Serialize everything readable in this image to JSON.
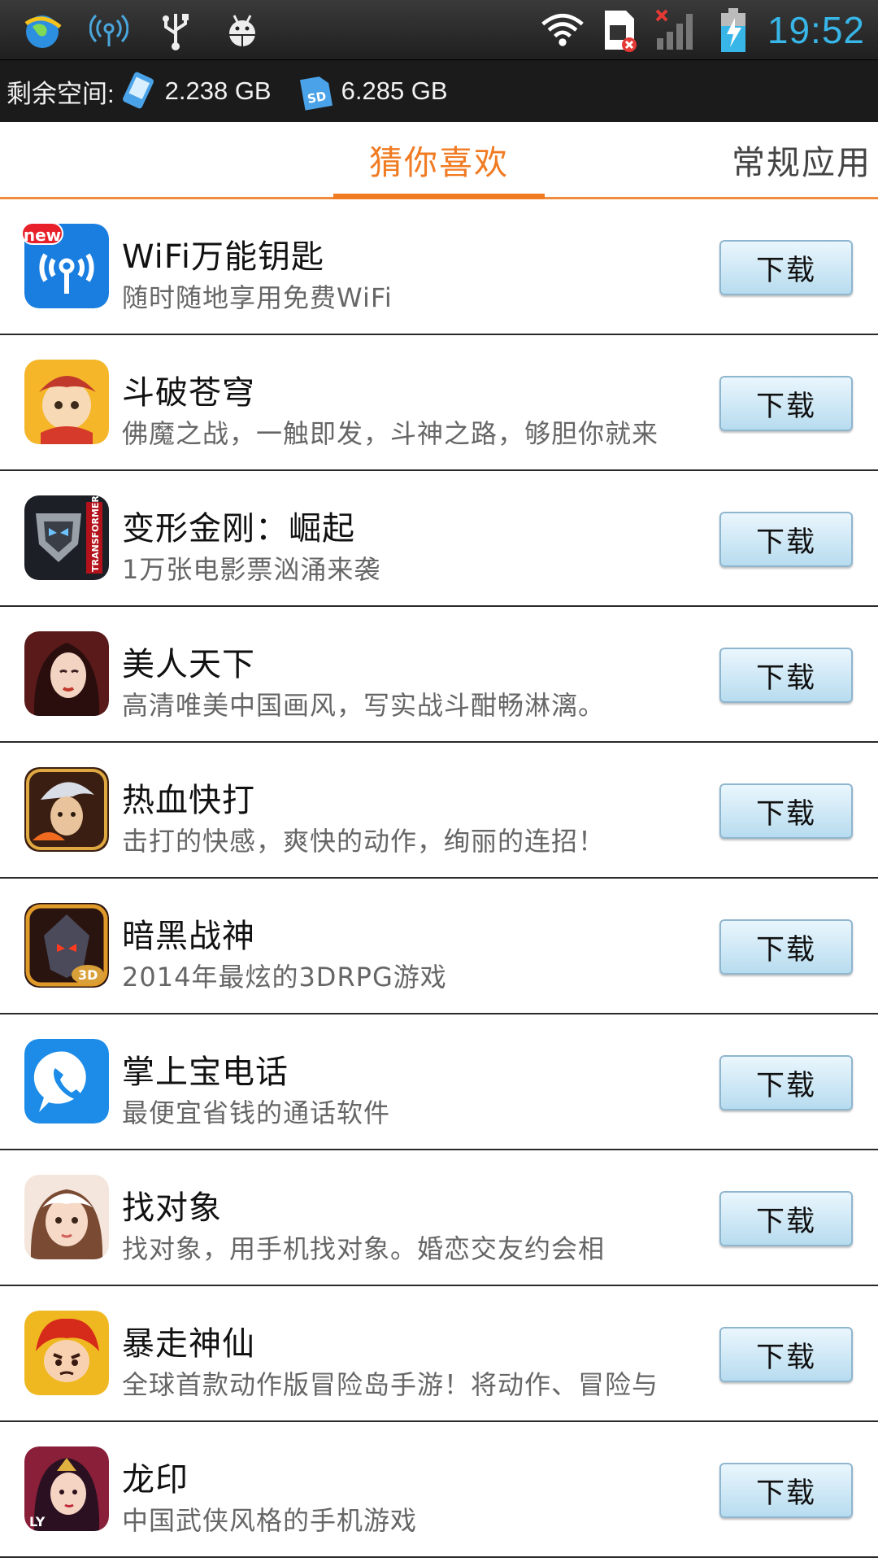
{
  "status_bar": {
    "clock": "19:52",
    "left_icons": [
      "browser-globe-icon",
      "hotspot-icon",
      "usb-icon",
      "android-debug-icon"
    ],
    "right_icons": [
      "wifi-icon",
      "sim-card-error-icon",
      "signal-no-service-icon",
      "battery-charging-icon"
    ],
    "accent_color": "#38b6e8"
  },
  "storage": {
    "label": "剩余空间:",
    "internal": "2.238 GB",
    "sd": "6.285 GB",
    "sd_icon_text": "SD"
  },
  "tabs": [
    {
      "label": "猜你喜欢",
      "active": true
    },
    {
      "label": "常规应用",
      "active": false
    }
  ],
  "accent_color": "#f07b22",
  "apps": [
    {
      "name": "WiFi万能钥匙",
      "desc": "随时随地享用免费WiFi",
      "button": "下载",
      "badge": "new",
      "icon": "wifi-key-icon"
    },
    {
      "name": "斗破苍穹",
      "desc": "佛魔之战，一触即发，斗神之路，够胆你就来",
      "button": "下载",
      "icon": "doupo-game-icon"
    },
    {
      "name": "变形金刚：崛起",
      "desc": "1万张电影票汹涌来袭",
      "button": "下载",
      "icon": "transformers-icon",
      "icon_text": "TRANSFORMERS"
    },
    {
      "name": "美人天下",
      "desc": "高清唯美中国画风，写实战斗酣畅淋漓。",
      "button": "下载",
      "icon": "beauty-game-icon"
    },
    {
      "name": "热血快打",
      "desc": "击打的快感，爽快的动作，绚丽的连招！",
      "button": "下载",
      "icon": "fighter-game-icon"
    },
    {
      "name": "暗黑战神",
      "desc": "2014年最炫的3DRPG游戏",
      "button": "下载",
      "icon": "dark-war-god-icon",
      "icon_text": "3D"
    },
    {
      "name": "掌上宝电话",
      "desc": "最便宜省钱的通话软件",
      "button": "下载",
      "icon": "phone-call-icon"
    },
    {
      "name": "找对象",
      "desc": " 找对象，用手机找对象。婚恋交友约会相",
      "button": "下载",
      "icon": "dating-icon"
    },
    {
      "name": "暴走神仙",
      "desc": "全球首款动作版冒险岛手游！将动作、冒险与",
      "button": "下载",
      "icon": "baozou-game-icon"
    },
    {
      "name": "龙印",
      "desc": "中国武侠风格的手机游戏",
      "button": "下载",
      "icon": "dragon-seal-icon",
      "icon_text": "LY"
    }
  ]
}
